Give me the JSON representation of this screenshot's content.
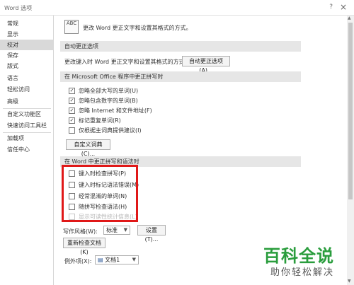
{
  "window": {
    "title": "Word 选项",
    "help": "?",
    "close": "×"
  },
  "sidebar": {
    "items": [
      "常规",
      "显示",
      "校对",
      "保存",
      "版式",
      "语言",
      "轻松访问",
      "高级",
      "自定义功能区",
      "快速访问工具栏",
      "加载项",
      "信任中心"
    ],
    "active_index": 2
  },
  "header": {
    "icon_text": "ABC",
    "description": "更改 Word 更正文字和设置其格式的方式。"
  },
  "autocorrect": {
    "heading": "自动更正选项",
    "desc": "更改键入时 Word 更正文字和设置其格式的方式：",
    "button": "自动更正选项(A)..."
  },
  "office": {
    "heading": "在 Microsoft Office 程序中更正拼写时",
    "options": [
      {
        "label": "忽略全部大写的单词(U)",
        "checked": true
      },
      {
        "label": "忽略包含数字的单词(B)",
        "checked": true
      },
      {
        "label": "忽略 Internet 和文件地址(F)",
        "checked": true
      },
      {
        "label": "标记重复单词(R)",
        "checked": true
      },
      {
        "label": "仅根据主词典提供建议(I)",
        "checked": false
      }
    ],
    "button": "自定义词典(C)..."
  },
  "word": {
    "heading": "在 Word 中更正拼写和语法时",
    "options": [
      {
        "label": "键入时检查拼写(P)",
        "checked": false,
        "disabled": false
      },
      {
        "label": "键入时标记语法错误(M)",
        "checked": false,
        "disabled": false
      },
      {
        "label": "经常混淆的单词(N)",
        "checked": false,
        "disabled": false
      },
      {
        "label": "随拼写检查语法(H)",
        "checked": false,
        "disabled": false
      },
      {
        "label": "显示可读性统计信息(L)",
        "checked": false,
        "disabled": true
      }
    ],
    "style_label": "写作风格(W):",
    "style_value": "标准",
    "settings_button": "设置(T)...",
    "recheck_button": "重新检查文档(K)"
  },
  "exceptions": {
    "label": "例外项(X):",
    "doc_value": "文档1"
  },
  "watermark": {
    "title": "百科全说",
    "subtitle": "助你轻松解决"
  },
  "colors": {
    "highlight": "#e01818",
    "watermark": "#2a9d3d"
  }
}
